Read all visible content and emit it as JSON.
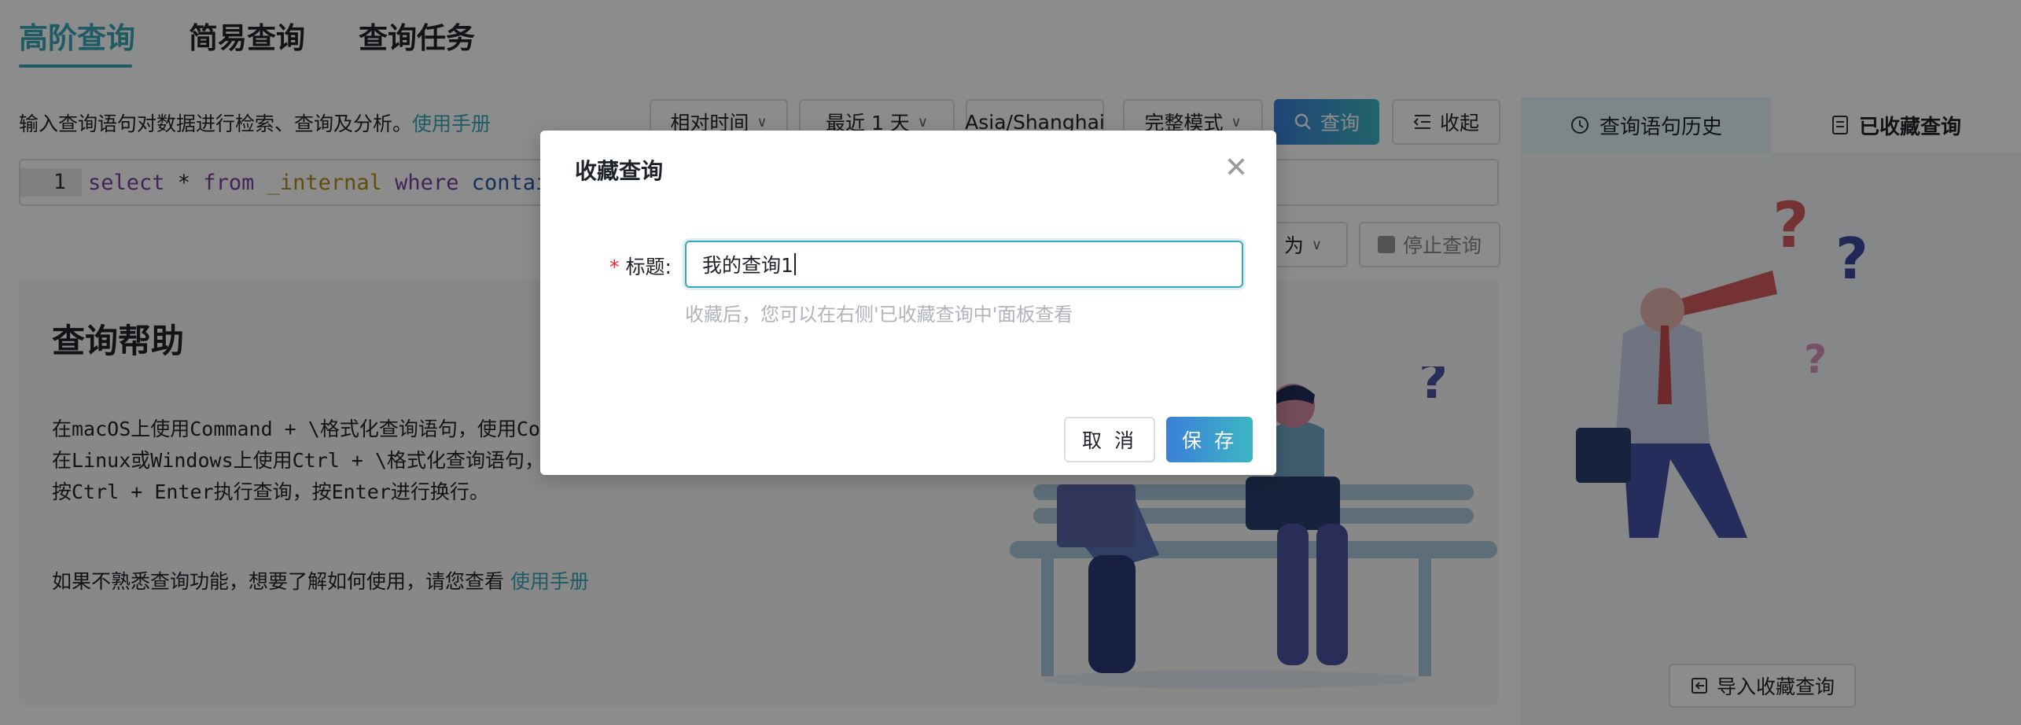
{
  "tabs": [
    {
      "label": "高阶查询",
      "active": true
    },
    {
      "label": "简易查询",
      "active": false
    },
    {
      "label": "查询任务",
      "active": false
    }
  ],
  "description": {
    "text": "输入查询语句对数据进行检索、查询及分析。",
    "link": "使用手册"
  },
  "toolbar": {
    "time_type": "相对时间",
    "time_range": "最近 1 天",
    "timezone": "Asia/Shanghai",
    "mode": "完整模式",
    "query_label": "查询",
    "collapse_label": "收起"
  },
  "editor": {
    "line_number": "1",
    "code": {
      "k1": "select",
      "star": " * ",
      "k2": "from",
      "table": " _internal ",
      "k3": "where",
      "fn": " contains"
    }
  },
  "actions": {
    "save_as_partial": "为",
    "stop_label": "停止查询"
  },
  "help": {
    "title": "查询帮助",
    "lines": [
      "在macOS上使用Command + \\格式化查询语句，使用Co",
      "在Linux或Windows上使用Ctrl + \\格式化查询语句，",
      "按Ctrl + Enter执行查询，按Enter进行换行。"
    ],
    "footer_text": "如果不熟悉查询功能，想要了解如何使用，请您查看 ",
    "footer_link": "使用手册"
  },
  "right_panel": {
    "tab_history": "查询语句历史",
    "tab_saved": "已收藏查询",
    "import_label": "导入收藏查询"
  },
  "modal": {
    "title": "收藏查询",
    "field_label": "标题:",
    "field_value": "我的查询1",
    "help_text": "收藏后，您可以在右侧'已收藏查询中'面板查看",
    "cancel_label": "取 消",
    "save_label": "保 存"
  },
  "colors": {
    "accent": "#3aa7b8",
    "primary_gradient_start": "#3c7fd9",
    "required": "#f5222d"
  }
}
